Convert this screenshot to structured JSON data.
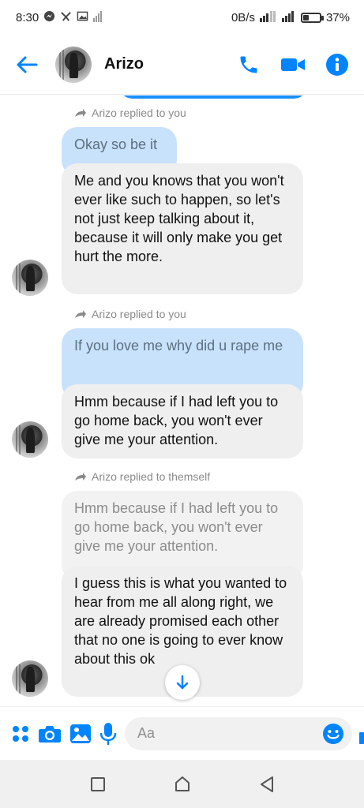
{
  "status_bar": {
    "time": "8:30",
    "network_speed": "0B/s",
    "battery_percent": "37%",
    "battery_level": 0.37
  },
  "header": {
    "contact_name": "Arizo"
  },
  "messages": [
    {
      "reply_label": "Arizo replied to you",
      "quoted": "Okay so be it",
      "text": "Me and you knows that you won't ever like such to happen, so let's not just keep talking about it, because it will only make you get hurt the more."
    },
    {
      "reply_label": "Arizo replied to you",
      "quoted": "If you love me why did u rape me",
      "text": "Hmm because if I had left you to go home back, you won't ever give me your attention."
    },
    {
      "reply_label": "Arizo replied to themself",
      "quoted": "Hmm because if I had left you to go home back, you won't ever give me your attention.",
      "text": "I guess this is what you wanted to hear from me all along right, we are already promised each other that no one is going to ever know about this ok"
    }
  ],
  "composer": {
    "placeholder": "Aa"
  },
  "colors": {
    "accent": "#0084ff",
    "quoted_bubble": "#c9e2fb",
    "message_bubble": "#efefef"
  },
  "icons": [
    "back-arrow-icon",
    "phone-icon",
    "video-camera-icon",
    "info-icon",
    "reply-arrow-icon",
    "menu-dots-icon",
    "camera-icon",
    "gallery-icon",
    "microphone-icon",
    "emoji-icon",
    "thumbs-up-icon",
    "scroll-down-icon",
    "recents-icon",
    "home-icon",
    "back-icon"
  ]
}
